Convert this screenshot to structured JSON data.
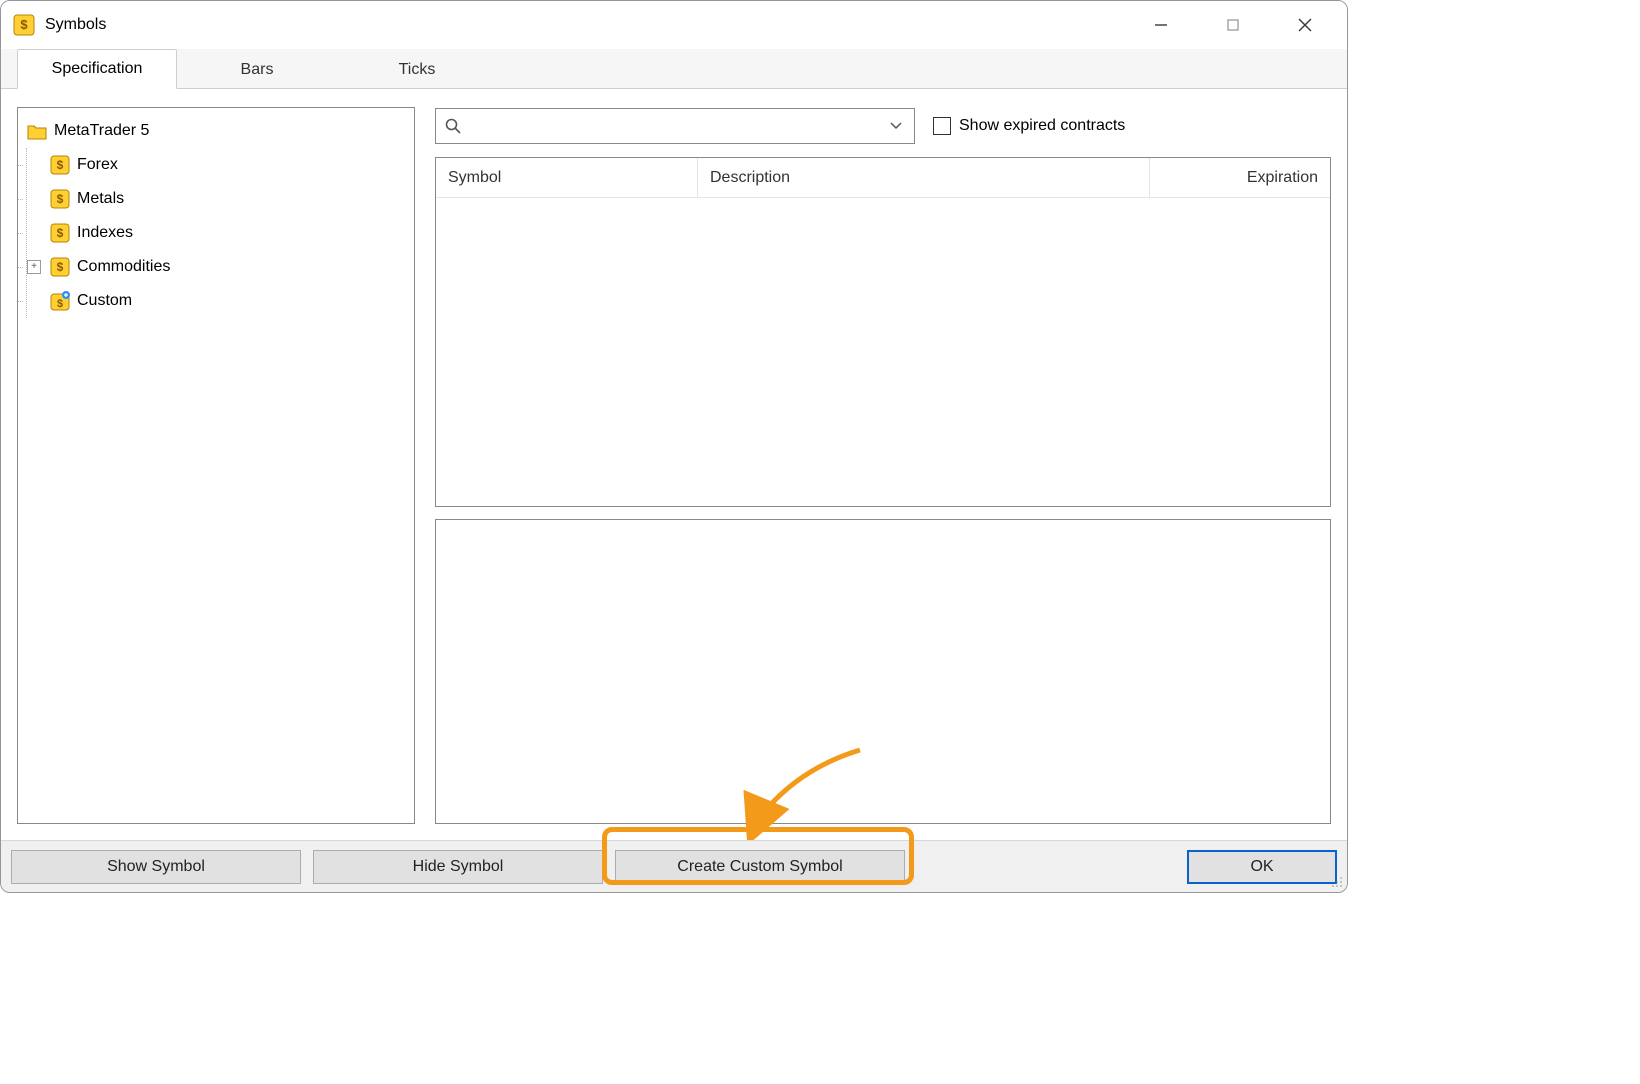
{
  "window": {
    "title": "Symbols"
  },
  "tabs": [
    {
      "label": "Specification"
    },
    {
      "label": "Bars"
    },
    {
      "label": "Ticks"
    }
  ],
  "tree": {
    "root_label": "MetaTrader 5",
    "items": [
      {
        "label": "Forex"
      },
      {
        "label": "Metals"
      },
      {
        "label": "Indexes"
      },
      {
        "label": "Commodities"
      },
      {
        "label": "Custom"
      }
    ]
  },
  "search": {
    "placeholder": ""
  },
  "show_expired_label": "Show expired contracts",
  "table": {
    "columns": {
      "symbol": "Symbol",
      "description": "Description",
      "expiration": "Expiration"
    }
  },
  "buttons": {
    "show_symbol": "Show Symbol",
    "hide_symbol": "Hide Symbol",
    "create_custom": "Create Custom Symbol",
    "ok": "OK"
  }
}
